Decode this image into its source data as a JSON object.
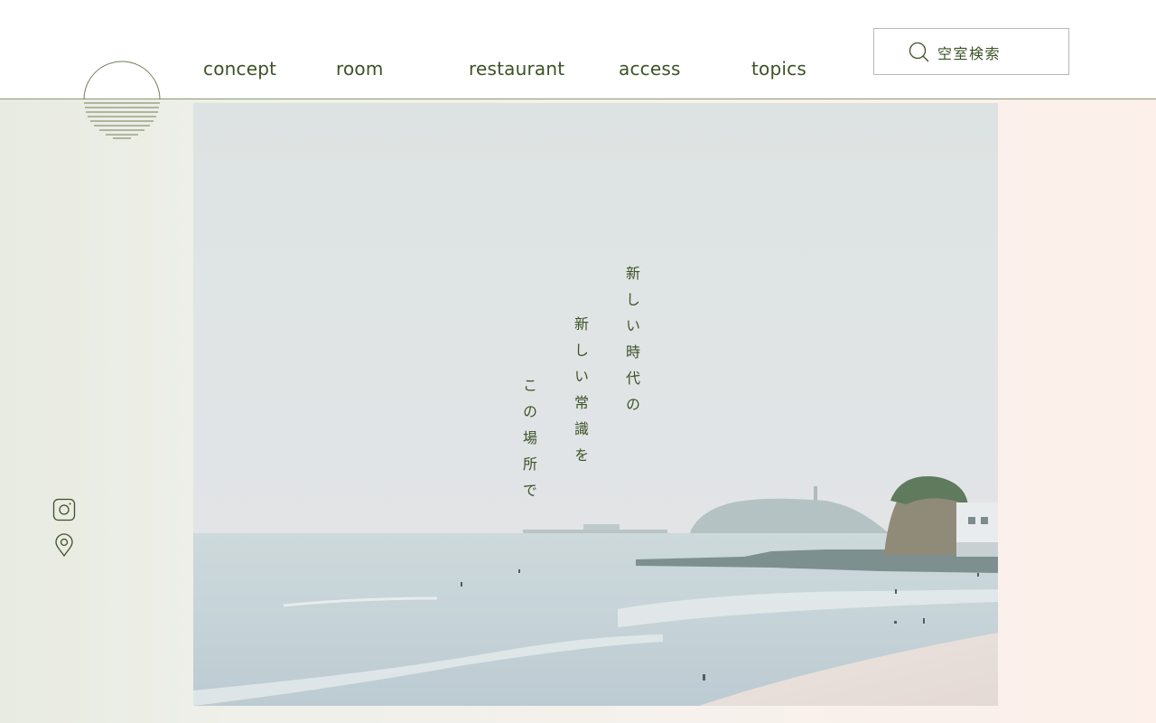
{
  "nav": {
    "items": [
      {
        "label": "concept"
      },
      {
        "label": "room"
      },
      {
        "label": "restaurant"
      },
      {
        "label": "access"
      },
      {
        "label": "topics"
      }
    ]
  },
  "search": {
    "label": "空室検索",
    "icon": "search-icon"
  },
  "hero": {
    "lines": [
      "新しい時代の",
      "新しい常識を",
      "この場所で"
    ],
    "image": "seaside-beach-photo"
  },
  "social": {
    "icons": [
      "instagram-icon",
      "map-pin-icon"
    ]
  },
  "colors": {
    "accent": "#3d5226",
    "rule": "#8a9a6f"
  }
}
